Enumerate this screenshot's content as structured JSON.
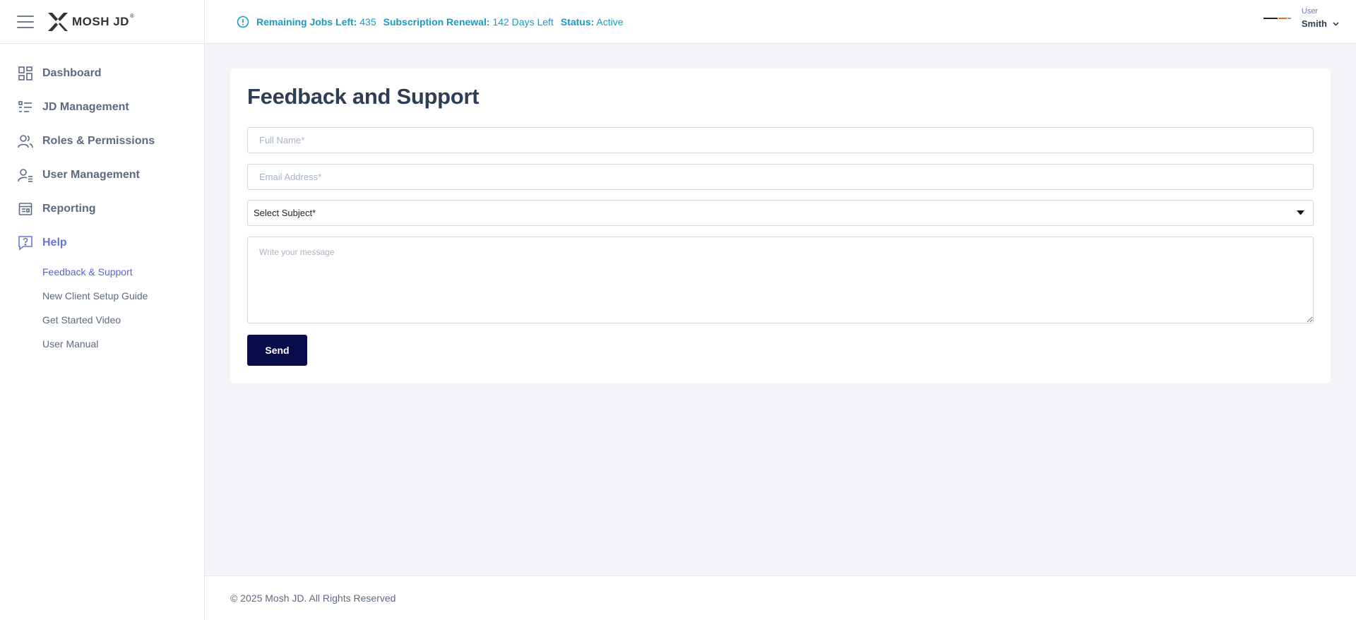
{
  "brand": {
    "logo_text": "MOSH JD",
    "registered": "®"
  },
  "sidebar": {
    "items": [
      {
        "label": "Dashboard",
        "icon": "dashboard-grid-icon"
      },
      {
        "label": "JD Management",
        "icon": "list-icon"
      },
      {
        "label": "Roles & Permissions",
        "icon": "users-icon"
      },
      {
        "label": "User Management",
        "icon": "user-list-icon"
      },
      {
        "label": "Reporting",
        "icon": "report-icon"
      },
      {
        "label": "Help",
        "icon": "help-chat-icon",
        "active": true
      }
    ],
    "help_subitems": [
      {
        "label": "Feedback & Support",
        "active": true
      },
      {
        "label": "New Client Setup Guide"
      },
      {
        "label": "Get Started Video"
      },
      {
        "label": "User Manual"
      }
    ]
  },
  "topbar": {
    "remaining_jobs_key": "Remaining Jobs Left:",
    "remaining_jobs_value": "435",
    "renewal_key": "Subscription Renewal:",
    "renewal_value": "142 Days Left",
    "status_key": "Status:",
    "status_value": "Active",
    "user_role": "User",
    "user_name": "Smith"
  },
  "form": {
    "title": "Feedback and Support",
    "full_name_placeholder": "Full Name*",
    "email_placeholder": "Email Address*",
    "subject_selected": "Select Subject*",
    "message_placeholder": "Write your message",
    "send_label": "Send"
  },
  "footer": {
    "copyright": "© 2025 Mosh JD. All Rights Reserved"
  },
  "colors": {
    "accent": "#6a74d6",
    "info": "#1a9bc4",
    "button": "#080c4a",
    "text": "#2d3e55"
  }
}
